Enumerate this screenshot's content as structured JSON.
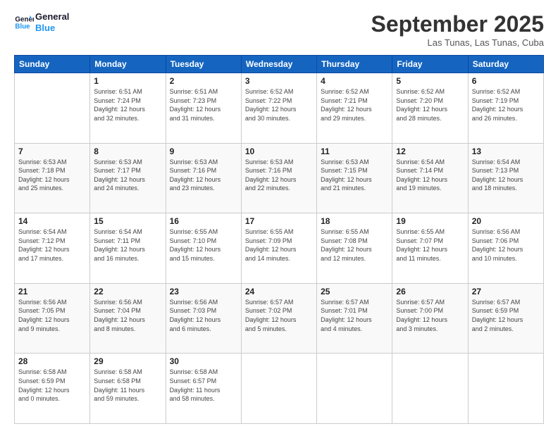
{
  "logo": {
    "line1": "General",
    "line2": "Blue"
  },
  "title": "September 2025",
  "subtitle": "Las Tunas, Las Tunas, Cuba",
  "days_of_week": [
    "Sunday",
    "Monday",
    "Tuesday",
    "Wednesday",
    "Thursday",
    "Friday",
    "Saturday"
  ],
  "weeks": [
    [
      {
        "day": "",
        "info": ""
      },
      {
        "day": "1",
        "info": "Sunrise: 6:51 AM\nSunset: 7:24 PM\nDaylight: 12 hours\nand 32 minutes."
      },
      {
        "day": "2",
        "info": "Sunrise: 6:51 AM\nSunset: 7:23 PM\nDaylight: 12 hours\nand 31 minutes."
      },
      {
        "day": "3",
        "info": "Sunrise: 6:52 AM\nSunset: 7:22 PM\nDaylight: 12 hours\nand 30 minutes."
      },
      {
        "day": "4",
        "info": "Sunrise: 6:52 AM\nSunset: 7:21 PM\nDaylight: 12 hours\nand 29 minutes."
      },
      {
        "day": "5",
        "info": "Sunrise: 6:52 AM\nSunset: 7:20 PM\nDaylight: 12 hours\nand 28 minutes."
      },
      {
        "day": "6",
        "info": "Sunrise: 6:52 AM\nSunset: 7:19 PM\nDaylight: 12 hours\nand 26 minutes."
      }
    ],
    [
      {
        "day": "7",
        "info": "Sunrise: 6:53 AM\nSunset: 7:18 PM\nDaylight: 12 hours\nand 25 minutes."
      },
      {
        "day": "8",
        "info": "Sunrise: 6:53 AM\nSunset: 7:17 PM\nDaylight: 12 hours\nand 24 minutes."
      },
      {
        "day": "9",
        "info": "Sunrise: 6:53 AM\nSunset: 7:16 PM\nDaylight: 12 hours\nand 23 minutes."
      },
      {
        "day": "10",
        "info": "Sunrise: 6:53 AM\nSunset: 7:16 PM\nDaylight: 12 hours\nand 22 minutes."
      },
      {
        "day": "11",
        "info": "Sunrise: 6:53 AM\nSunset: 7:15 PM\nDaylight: 12 hours\nand 21 minutes."
      },
      {
        "day": "12",
        "info": "Sunrise: 6:54 AM\nSunset: 7:14 PM\nDaylight: 12 hours\nand 19 minutes."
      },
      {
        "day": "13",
        "info": "Sunrise: 6:54 AM\nSunset: 7:13 PM\nDaylight: 12 hours\nand 18 minutes."
      }
    ],
    [
      {
        "day": "14",
        "info": "Sunrise: 6:54 AM\nSunset: 7:12 PM\nDaylight: 12 hours\nand 17 minutes."
      },
      {
        "day": "15",
        "info": "Sunrise: 6:54 AM\nSunset: 7:11 PM\nDaylight: 12 hours\nand 16 minutes."
      },
      {
        "day": "16",
        "info": "Sunrise: 6:55 AM\nSunset: 7:10 PM\nDaylight: 12 hours\nand 15 minutes."
      },
      {
        "day": "17",
        "info": "Sunrise: 6:55 AM\nSunset: 7:09 PM\nDaylight: 12 hours\nand 14 minutes."
      },
      {
        "day": "18",
        "info": "Sunrise: 6:55 AM\nSunset: 7:08 PM\nDaylight: 12 hours\nand 12 minutes."
      },
      {
        "day": "19",
        "info": "Sunrise: 6:55 AM\nSunset: 7:07 PM\nDaylight: 12 hours\nand 11 minutes."
      },
      {
        "day": "20",
        "info": "Sunrise: 6:56 AM\nSunset: 7:06 PM\nDaylight: 12 hours\nand 10 minutes."
      }
    ],
    [
      {
        "day": "21",
        "info": "Sunrise: 6:56 AM\nSunset: 7:05 PM\nDaylight: 12 hours\nand 9 minutes."
      },
      {
        "day": "22",
        "info": "Sunrise: 6:56 AM\nSunset: 7:04 PM\nDaylight: 12 hours\nand 8 minutes."
      },
      {
        "day": "23",
        "info": "Sunrise: 6:56 AM\nSunset: 7:03 PM\nDaylight: 12 hours\nand 6 minutes."
      },
      {
        "day": "24",
        "info": "Sunrise: 6:57 AM\nSunset: 7:02 PM\nDaylight: 12 hours\nand 5 minutes."
      },
      {
        "day": "25",
        "info": "Sunrise: 6:57 AM\nSunset: 7:01 PM\nDaylight: 12 hours\nand 4 minutes."
      },
      {
        "day": "26",
        "info": "Sunrise: 6:57 AM\nSunset: 7:00 PM\nDaylight: 12 hours\nand 3 minutes."
      },
      {
        "day": "27",
        "info": "Sunrise: 6:57 AM\nSunset: 6:59 PM\nDaylight: 12 hours\nand 2 minutes."
      }
    ],
    [
      {
        "day": "28",
        "info": "Sunrise: 6:58 AM\nSunset: 6:59 PM\nDaylight: 12 hours\nand 0 minutes."
      },
      {
        "day": "29",
        "info": "Sunrise: 6:58 AM\nSunset: 6:58 PM\nDaylight: 11 hours\nand 59 minutes."
      },
      {
        "day": "30",
        "info": "Sunrise: 6:58 AM\nSunset: 6:57 PM\nDaylight: 11 hours\nand 58 minutes."
      },
      {
        "day": "",
        "info": ""
      },
      {
        "day": "",
        "info": ""
      },
      {
        "day": "",
        "info": ""
      },
      {
        "day": "",
        "info": ""
      }
    ]
  ]
}
